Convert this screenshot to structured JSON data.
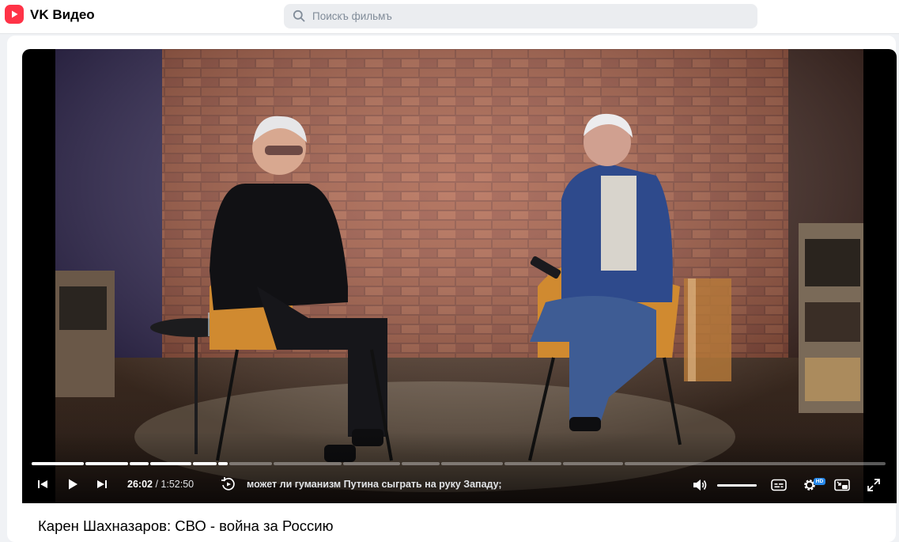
{
  "app": {
    "title": "VK Видео",
    "brand_color": "#ff3347"
  },
  "search": {
    "placeholder": "Поискъ фильмъ",
    "icon": "search-icon"
  },
  "player": {
    "current_time": "26:02",
    "separator": " / ",
    "duration": "1:52:50",
    "subtitle": "может ли гуманизм Путина сыграть на руку Западу;",
    "progress_fraction": 0.23,
    "volume_fraction": 1.0,
    "quality_badge": "HD",
    "controls": [
      "previous-icon",
      "play-icon",
      "next-icon",
      "replay-chapter-icon",
      "volume-icon",
      "subtitles-icon",
      "settings-icon",
      "pip-icon",
      "fullscreen-icon"
    ]
  },
  "video": {
    "title": "Карен Шахназаров: СВО - война за Россию"
  }
}
